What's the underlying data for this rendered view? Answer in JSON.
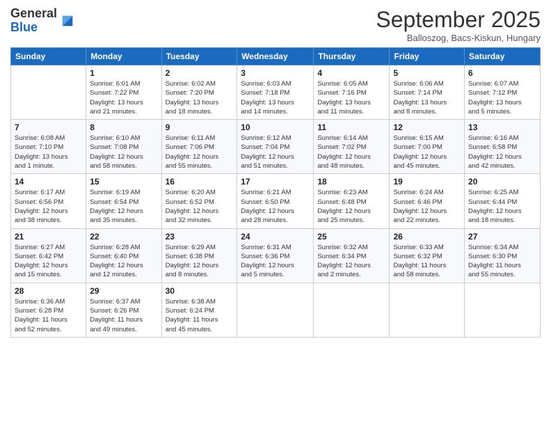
{
  "header": {
    "logo_general": "General",
    "logo_blue": "Blue",
    "title": "September 2025",
    "location": "Balloszog, Bacs-Kiskun, Hungary"
  },
  "days_of_week": [
    "Sunday",
    "Monday",
    "Tuesday",
    "Wednesday",
    "Thursday",
    "Friday",
    "Saturday"
  ],
  "weeks": [
    [
      {
        "day": "",
        "info": ""
      },
      {
        "day": "1",
        "info": "Sunrise: 6:01 AM\nSunset: 7:22 PM\nDaylight: 13 hours\nand 21 minutes."
      },
      {
        "day": "2",
        "info": "Sunrise: 6:02 AM\nSunset: 7:20 PM\nDaylight: 13 hours\nand 18 minutes."
      },
      {
        "day": "3",
        "info": "Sunrise: 6:03 AM\nSunset: 7:18 PM\nDaylight: 13 hours\nand 14 minutes."
      },
      {
        "day": "4",
        "info": "Sunrise: 6:05 AM\nSunset: 7:16 PM\nDaylight: 13 hours\nand 11 minutes."
      },
      {
        "day": "5",
        "info": "Sunrise: 6:06 AM\nSunset: 7:14 PM\nDaylight: 13 hours\nand 8 minutes."
      },
      {
        "day": "6",
        "info": "Sunrise: 6:07 AM\nSunset: 7:12 PM\nDaylight: 13 hours\nand 5 minutes."
      }
    ],
    [
      {
        "day": "7",
        "info": "Sunrise: 6:08 AM\nSunset: 7:10 PM\nDaylight: 13 hours\nand 1 minute."
      },
      {
        "day": "8",
        "info": "Sunrise: 6:10 AM\nSunset: 7:08 PM\nDaylight: 12 hours\nand 58 minutes."
      },
      {
        "day": "9",
        "info": "Sunrise: 6:11 AM\nSunset: 7:06 PM\nDaylight: 12 hours\nand 55 minutes."
      },
      {
        "day": "10",
        "info": "Sunrise: 6:12 AM\nSunset: 7:04 PM\nDaylight: 12 hours\nand 51 minutes."
      },
      {
        "day": "11",
        "info": "Sunrise: 6:14 AM\nSunset: 7:02 PM\nDaylight: 12 hours\nand 48 minutes."
      },
      {
        "day": "12",
        "info": "Sunrise: 6:15 AM\nSunset: 7:00 PM\nDaylight: 12 hours\nand 45 minutes."
      },
      {
        "day": "13",
        "info": "Sunrise: 6:16 AM\nSunset: 6:58 PM\nDaylight: 12 hours\nand 42 minutes."
      }
    ],
    [
      {
        "day": "14",
        "info": "Sunrise: 6:17 AM\nSunset: 6:56 PM\nDaylight: 12 hours\nand 38 minutes."
      },
      {
        "day": "15",
        "info": "Sunrise: 6:19 AM\nSunset: 6:54 PM\nDaylight: 12 hours\nand 35 minutes."
      },
      {
        "day": "16",
        "info": "Sunrise: 6:20 AM\nSunset: 6:52 PM\nDaylight: 12 hours\nand 32 minutes."
      },
      {
        "day": "17",
        "info": "Sunrise: 6:21 AM\nSunset: 6:50 PM\nDaylight: 12 hours\nand 28 minutes."
      },
      {
        "day": "18",
        "info": "Sunrise: 6:23 AM\nSunset: 6:48 PM\nDaylight: 12 hours\nand 25 minutes."
      },
      {
        "day": "19",
        "info": "Sunrise: 6:24 AM\nSunset: 6:46 PM\nDaylight: 12 hours\nand 22 minutes."
      },
      {
        "day": "20",
        "info": "Sunrise: 6:25 AM\nSunset: 6:44 PM\nDaylight: 12 hours\nand 18 minutes."
      }
    ],
    [
      {
        "day": "21",
        "info": "Sunrise: 6:27 AM\nSunset: 6:42 PM\nDaylight: 12 hours\nand 15 minutes."
      },
      {
        "day": "22",
        "info": "Sunrise: 6:28 AM\nSunset: 6:40 PM\nDaylight: 12 hours\nand 12 minutes."
      },
      {
        "day": "23",
        "info": "Sunrise: 6:29 AM\nSunset: 6:38 PM\nDaylight: 12 hours\nand 8 minutes."
      },
      {
        "day": "24",
        "info": "Sunrise: 6:31 AM\nSunset: 6:36 PM\nDaylight: 12 hours\nand 5 minutes."
      },
      {
        "day": "25",
        "info": "Sunrise: 6:32 AM\nSunset: 6:34 PM\nDaylight: 12 hours\nand 2 minutes."
      },
      {
        "day": "26",
        "info": "Sunrise: 6:33 AM\nSunset: 6:32 PM\nDaylight: 11 hours\nand 58 minutes."
      },
      {
        "day": "27",
        "info": "Sunrise: 6:34 AM\nSunset: 6:30 PM\nDaylight: 11 hours\nand 55 minutes."
      }
    ],
    [
      {
        "day": "28",
        "info": "Sunrise: 6:36 AM\nSunset: 6:28 PM\nDaylight: 11 hours\nand 52 minutes."
      },
      {
        "day": "29",
        "info": "Sunrise: 6:37 AM\nSunset: 6:26 PM\nDaylight: 11 hours\nand 49 minutes."
      },
      {
        "day": "30",
        "info": "Sunrise: 6:38 AM\nSunset: 6:24 PM\nDaylight: 11 hours\nand 45 minutes."
      },
      {
        "day": "",
        "info": ""
      },
      {
        "day": "",
        "info": ""
      },
      {
        "day": "",
        "info": ""
      },
      {
        "day": "",
        "info": ""
      }
    ]
  ]
}
